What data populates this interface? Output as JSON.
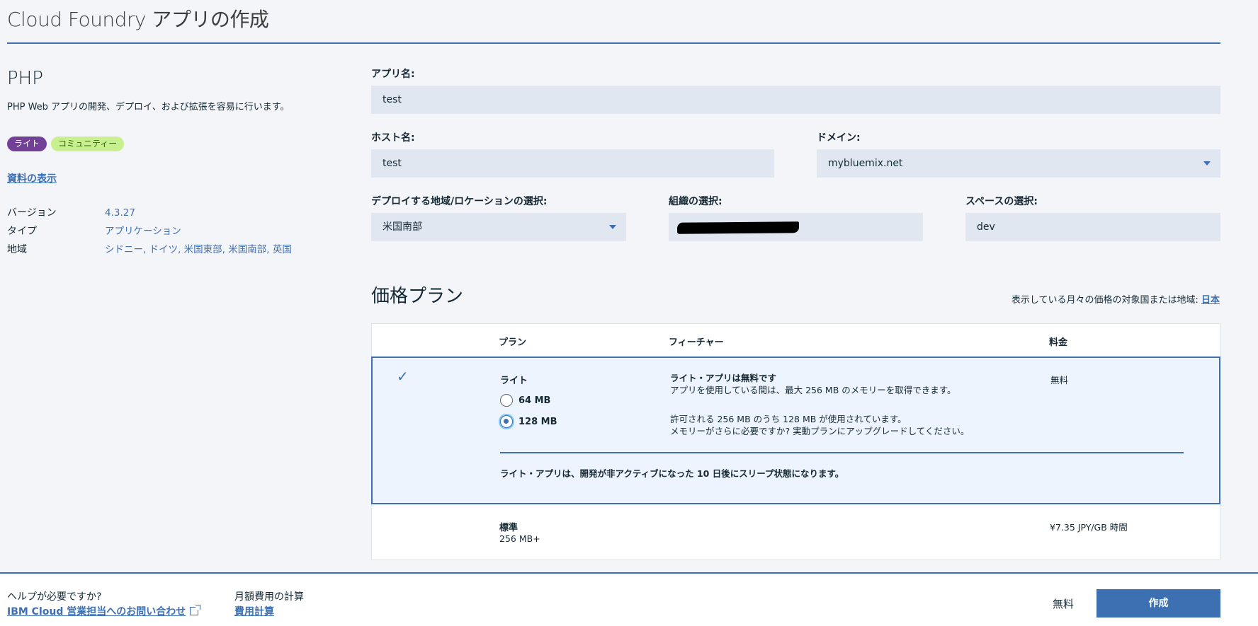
{
  "page": {
    "title": "Cloud Foundry アプリの作成"
  },
  "service": {
    "name": "PHP",
    "description": "PHP Web アプリの開発、デプロイ、および拡張を容易に行います。",
    "tags": [
      "ライト",
      "コミュニティー"
    ],
    "doc_link": "資料の表示",
    "meta": [
      {
        "key": "バージョン",
        "value": "4.3.27"
      },
      {
        "key": "タイプ",
        "value": "アプリケーション"
      },
      {
        "key": "地域",
        "value": "シドニー, ドイツ, 米国東部, 米国南部, 英国"
      }
    ]
  },
  "form": {
    "app_name": {
      "label": "アプリ名:",
      "value": "test"
    },
    "host_name": {
      "label": "ホスト名:",
      "value": "test"
    },
    "domain": {
      "label": "ドメイン:",
      "value": "mybluemix.net"
    },
    "region": {
      "label": "デプロイする地域/ロケーションの選択:",
      "value": "米国南部"
    },
    "org": {
      "label": "組織の選択:",
      "value": ""
    },
    "space": {
      "label": "スペースの選択:",
      "value": "dev"
    }
  },
  "pricing": {
    "title": "価格プラン",
    "region_note": "表示している月々の価格の対象国または地域: ",
    "region_link": "日本",
    "headers": {
      "plan": "プラン",
      "features": "フィーチャー",
      "price": "料金"
    },
    "lite": {
      "name": "ライト",
      "options": [
        "64 MB",
        "128 MB"
      ],
      "selected": "128 MB",
      "feature_title": "ライト・アプリは無料です",
      "feature_line1": "アプリを使用している間は、最大 256 MB のメモリーを取得できます。",
      "feature_line2": "許可される 256 MB のうち 128 MB が使用されています。",
      "feature_line3": "メモリーがさらに必要ですか? 実動プランにアップグレードしてください。",
      "price": "無料",
      "sleep_note": "ライト・アプリは、開発が非アクティブになった 10 日後にスリープ状態になります。"
    },
    "standard": {
      "name": "標準",
      "memory": "256 MB+",
      "price": "¥7.35 JPY/GB 時間"
    }
  },
  "footer": {
    "help_question": "ヘルプが必要ですか?",
    "help_link": "IBM Cloud 営業担当へのお問い合わせ",
    "calc_label": "月額費用の計算",
    "calc_link": "費用計算",
    "total": "無料",
    "create_button": "作成"
  },
  "colors": {
    "accent": "#3d70b2",
    "lite_tag": "#734098",
    "community_tag": "#c8f08f"
  }
}
